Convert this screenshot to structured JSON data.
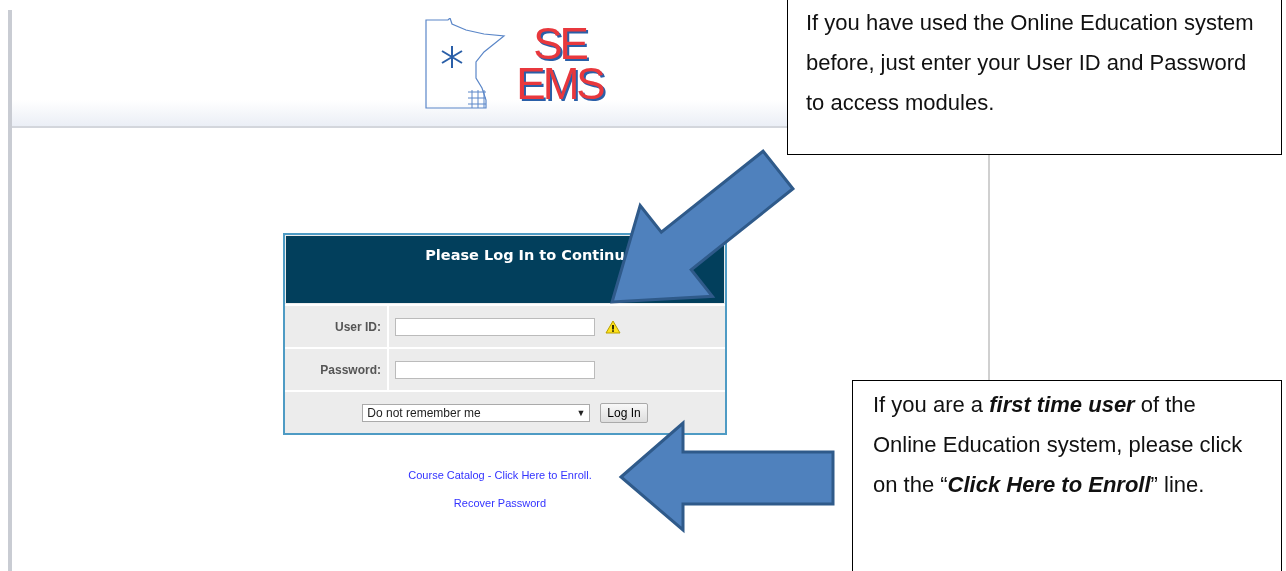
{
  "logo": {
    "lines": [
      "SE",
      "EMS"
    ]
  },
  "login": {
    "title": "Please Log In to Continu",
    "fields": [
      {
        "label": "User ID:",
        "warning": true
      },
      {
        "label": "Password:",
        "warning": false
      }
    ],
    "remember": {
      "value": "Do not remember me",
      "caret": "▼"
    },
    "button": "Log In"
  },
  "links": [
    "Course Catalog - Click Here to Enroll.",
    "Recover Password"
  ],
  "callouts": [
    {
      "text": "If you have used the Online Education system before, just enter your User ID and Password to access modules."
    },
    {
      "text": "If you are a **first time user** of the Online Education system, please click on the “**Click Here to Enroll**” line."
    }
  ]
}
